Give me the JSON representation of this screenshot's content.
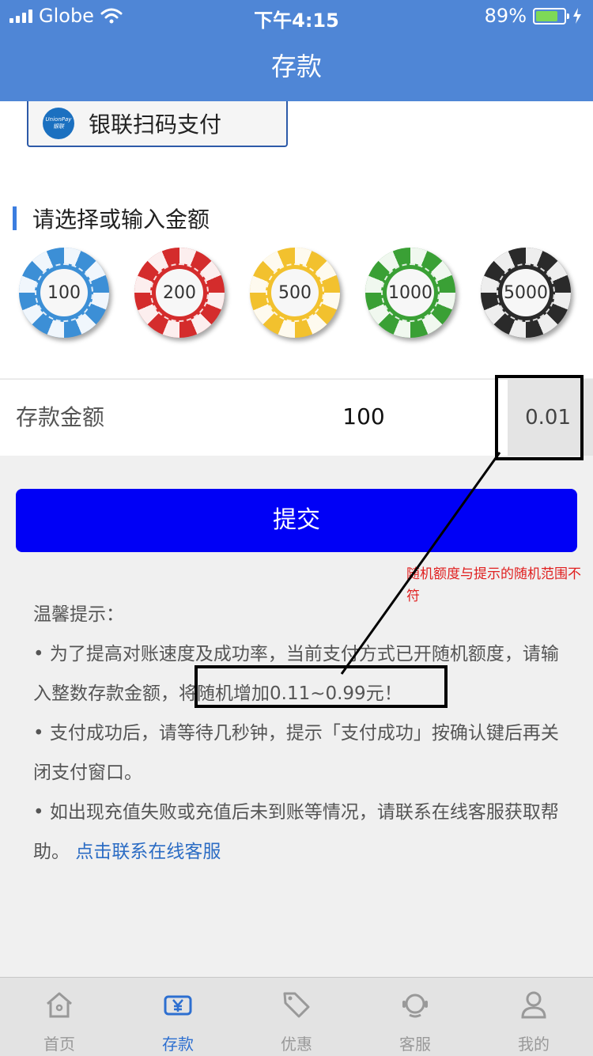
{
  "status_bar": {
    "carrier": "Globe",
    "time": "下午4:15",
    "battery": "89%",
    "battery_level": 0.89
  },
  "nav": {
    "title": "存款"
  },
  "payment_method": {
    "label": "银联扫码支付",
    "logo_text": "UnionPay 银联"
  },
  "amount_section": {
    "title": "请选择或输入金额"
  },
  "chips": [
    {
      "value": "100",
      "color": "#3c8fd6"
    },
    {
      "value": "200",
      "color": "#d42c2c"
    },
    {
      "value": "500",
      "color": "#f2c12e"
    },
    {
      "value": "1000",
      "color": "#3aa035"
    },
    {
      "value": "5000",
      "color": "#2a2a2a"
    }
  ],
  "deposit": {
    "label": "存款金额",
    "amount": "100",
    "cents": "0.01"
  },
  "submit": {
    "label": "提交"
  },
  "annotation": {
    "text": "随机额度与提示的随机范围不符"
  },
  "tips": {
    "title": "温馨提示：",
    "item1_part1": "• 为了提高对账速度及成功率，当前支付方式已开随机额度，请输入整数存款金额，",
    "item1_part2": "将随机增加0.11~0.99元！",
    "item2": "• 支付成功后，请等待几秒钟，提示「支付成功」按确认键后再关闭支付窗口。",
    "item3": "• 如出现充值失败或充值后未到账等情况，请联系在线客服获取帮助。",
    "link": "点击联系在线客服"
  },
  "tabs": [
    {
      "label": "首页",
      "icon": "home-icon",
      "active": false
    },
    {
      "label": "存款",
      "icon": "deposit-icon",
      "active": true
    },
    {
      "label": "优惠",
      "icon": "tag-icon",
      "active": false
    },
    {
      "label": "客服",
      "icon": "headset-icon",
      "active": false
    },
    {
      "label": "我的",
      "icon": "user-icon",
      "active": false
    }
  ],
  "colors": {
    "brand": "#4f86d6",
    "submit": "#0000f6",
    "annotation": "#e02020",
    "link": "#2b6cc4"
  }
}
